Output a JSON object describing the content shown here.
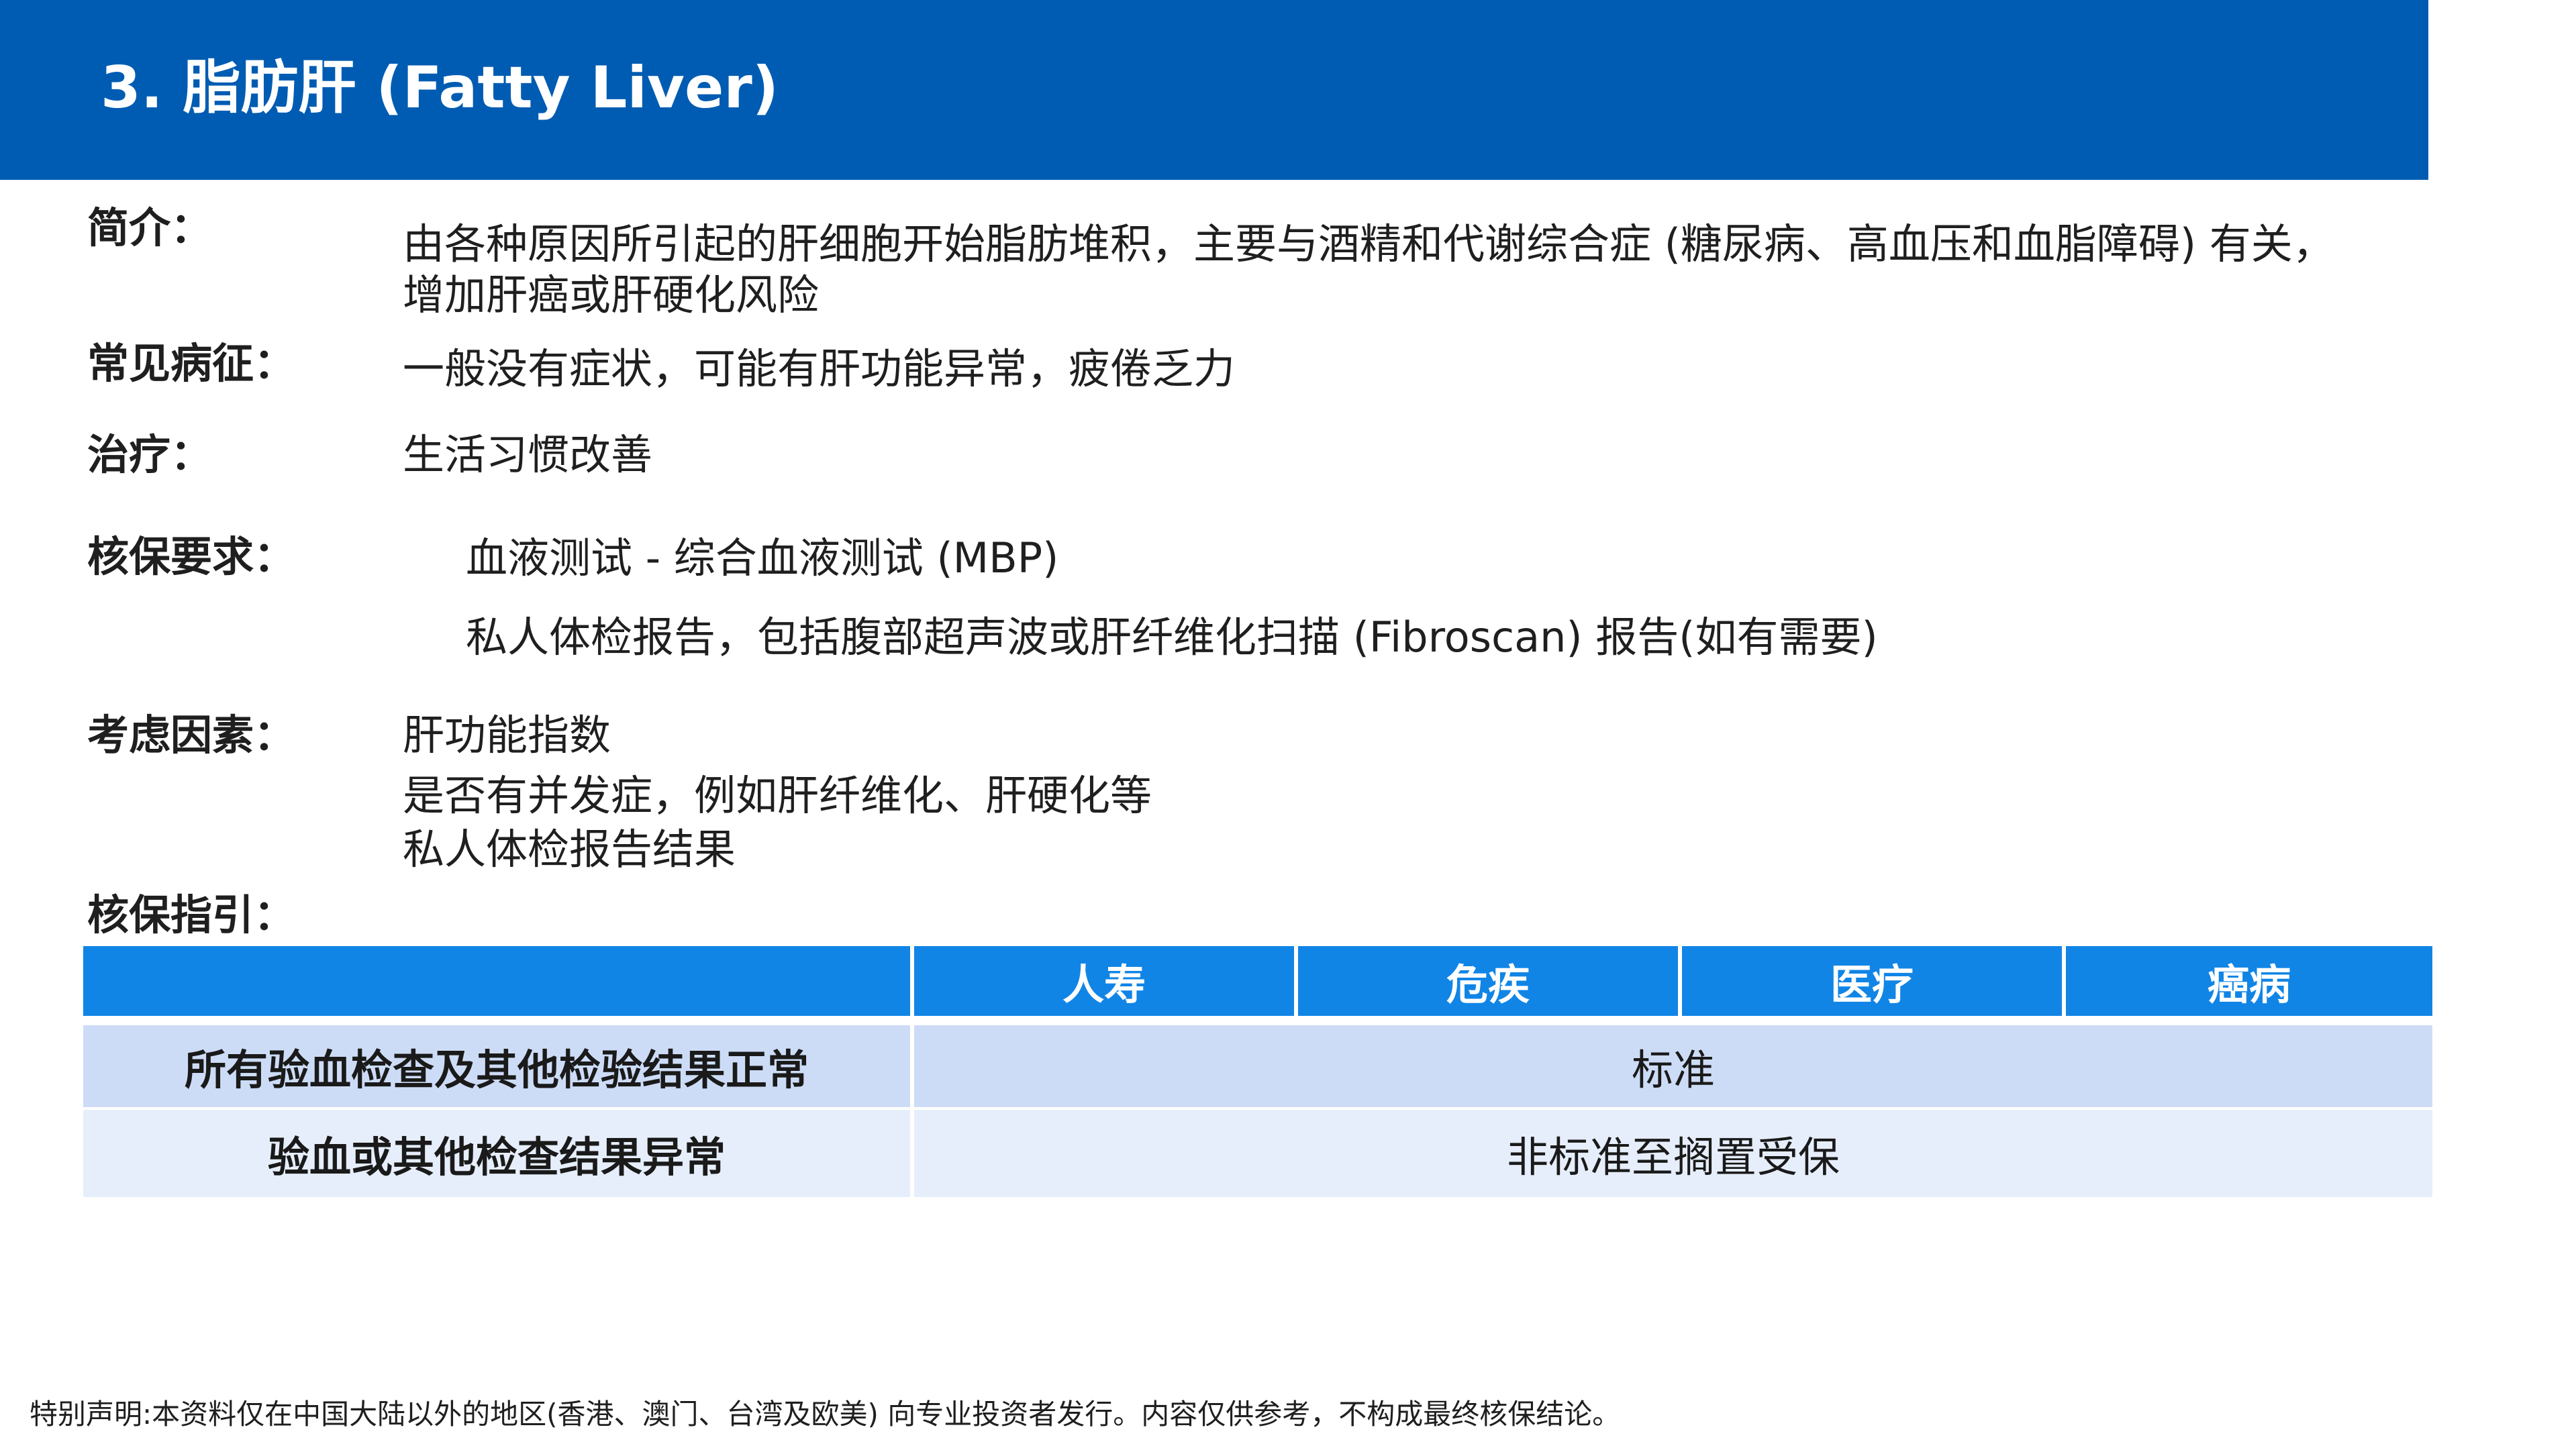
{
  "header": {
    "title": "3. 脂肪肝 (Fatty Liver)"
  },
  "intro": {
    "label": "简介：",
    "line1": "由各种原因所引起的肝细胞开始脂肪堆积，主要与酒精和代谢综合症 (糖尿病、高血压和血脂障碍) 有关，",
    "line2": "增加肝癌或肝硬化风险"
  },
  "symptoms": {
    "label": "常见病征：",
    "text": "一般没有症状，可能有肝功能异常，疲倦乏力"
  },
  "treatment": {
    "label": "治疗：",
    "text": "生活习惯改善"
  },
  "requirements": {
    "label": "核保要求：",
    "bullet": "",
    "items": [
      "血液测试 - 综合血液测试 (MBP)",
      "私人体检报告，包括腹部超声波或肝纤维化扫描 (Fibroscan) 报告(如有需要)"
    ]
  },
  "factors": {
    "label": "考虑因素：",
    "items": [
      "肝功能指数",
      "是否有并发症，例如肝纤维化、肝硬化等",
      "私人体检报告结果"
    ]
  },
  "guideline": {
    "label": "核保指引：",
    "columns": [
      "",
      "人寿",
      "危疾",
      "医疗",
      "癌病"
    ],
    "rows": [
      {
        "condition": "所有验血检查及其他检验结果正常",
        "result": "标准"
      },
      {
        "condition": "验血或其他检查结果异常",
        "result": "非标准至搁置受保"
      }
    ],
    "colors": {
      "header": "#1185e6",
      "row1": "#cddcf6",
      "row2": "#e6eefb"
    }
  },
  "footer": {
    "text": "特别声明:本资料仅在中国大陆以外的地区(香港、澳门、台湾及欧美) 向专业投资者发行。内容仅供参考，不构成最终核保结论。"
  },
  "colors": {
    "brand": "#005cb2"
  }
}
